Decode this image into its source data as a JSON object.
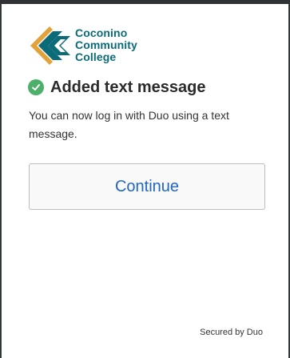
{
  "branding": {
    "logo_lines": [
      "Coconino",
      "Community",
      "College"
    ],
    "logo_icon": "chevron-logo-icon",
    "brand_colors": {
      "teal": "#0b6b78",
      "gold": "#e2a23a"
    }
  },
  "status": {
    "icon": "check-circle-icon",
    "icon_color": "#4caf6a",
    "title": "Added text message",
    "message": "You can now log in with Duo using a text message."
  },
  "actions": {
    "continue_label": "Continue",
    "continue_color": "#1f66c4"
  },
  "footer": {
    "secured_by": "Secured by Duo"
  }
}
